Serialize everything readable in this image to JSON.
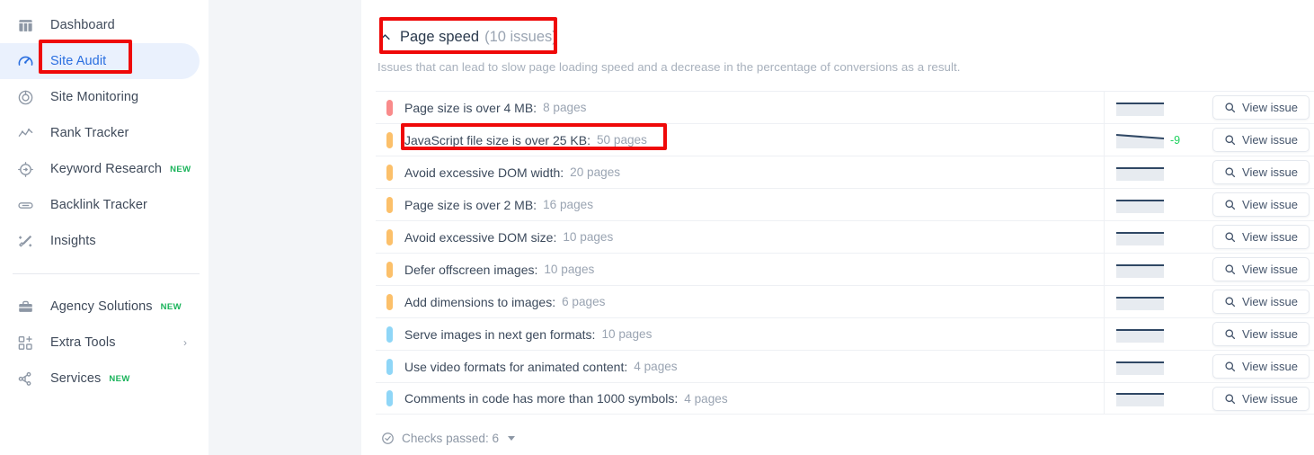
{
  "sidebar": {
    "items": [
      {
        "label": "Dashboard",
        "icon": "dashboard-icon",
        "active": false,
        "badge": "",
        "chevron": false
      },
      {
        "label": "Site Audit",
        "icon": "site-audit-icon",
        "active": true,
        "badge": "",
        "chevron": false
      },
      {
        "label": "Site Monitoring",
        "icon": "site-monitoring-icon",
        "active": false,
        "badge": "",
        "chevron": false
      },
      {
        "label": "Rank Tracker",
        "icon": "rank-tracker-icon",
        "active": false,
        "badge": "",
        "chevron": false
      },
      {
        "label": "Keyword Research",
        "icon": "keyword-research-icon",
        "active": false,
        "badge": "NEW",
        "chevron": false
      },
      {
        "label": "Backlink Tracker",
        "icon": "backlink-tracker-icon",
        "active": false,
        "badge": "",
        "chevron": false
      },
      {
        "label": "Insights",
        "icon": "insights-icon",
        "active": false,
        "badge": "",
        "chevron": false
      }
    ],
    "items_secondary": [
      {
        "label": "Agency Solutions",
        "icon": "briefcase-icon",
        "active": false,
        "badge": "NEW",
        "chevron": false
      },
      {
        "label": "Extra Tools",
        "icon": "extra-tools-icon",
        "active": false,
        "badge": "",
        "chevron": true
      },
      {
        "label": "Services",
        "icon": "services-icon",
        "active": false,
        "badge": "NEW",
        "chevron": false
      }
    ]
  },
  "section": {
    "collapse_icon": "chevron-up-icon",
    "title": "Page speed",
    "count": "(10 issues)",
    "description": "Issues that can lead to slow page loading speed and a decrease in the percentage of conversions as a result."
  },
  "issues": {
    "view_issue_label": "View issue",
    "search_icon": "search-icon",
    "rows": [
      {
        "label": "Page size is over 4 MB:",
        "count": "8 pages",
        "severity": "critical",
        "severity_color": "#f98b8b",
        "delta": "",
        "spark_slope": 0
      },
      {
        "label": "JavaScript file size is over 25 KB:",
        "count": "50 pages",
        "severity": "warning",
        "severity_color": "#fcc06a",
        "delta": "-9",
        "spark_slope": 1
      },
      {
        "label": "Avoid excessive DOM width:",
        "count": "20 pages",
        "severity": "warning",
        "severity_color": "#fcc06a",
        "delta": "",
        "spark_slope": 0
      },
      {
        "label": "Page size is over 2 MB:",
        "count": "16 pages",
        "severity": "warning",
        "severity_color": "#fcc06a",
        "delta": "",
        "spark_slope": 0
      },
      {
        "label": "Avoid excessive DOM size:",
        "count": "10 pages",
        "severity": "warning",
        "severity_color": "#fcc06a",
        "delta": "",
        "spark_slope": 0
      },
      {
        "label": "Defer offscreen images:",
        "count": "10 pages",
        "severity": "warning",
        "severity_color": "#fcc06a",
        "delta": "",
        "spark_slope": 0
      },
      {
        "label": "Add dimensions to images:",
        "count": "6 pages",
        "severity": "warning",
        "severity_color": "#fcc06a",
        "delta": "",
        "spark_slope": 0
      },
      {
        "label": "Serve images in next gen formats:",
        "count": "10 pages",
        "severity": "notice",
        "severity_color": "#8fd6f7",
        "delta": "",
        "spark_slope": 0
      },
      {
        "label": "Use video formats for animated content:",
        "count": "4 pages",
        "severity": "notice",
        "severity_color": "#8fd6f7",
        "delta": "",
        "spark_slope": 0
      },
      {
        "label": "Comments in code has more than 1000 symbols:",
        "count": "4 pages",
        "severity": "notice",
        "severity_color": "#8fd6f7",
        "delta": "",
        "spark_slope": 0
      }
    ]
  },
  "footer": {
    "checks_icon": "check-circle-icon",
    "checks_label": "Checks passed: 6"
  },
  "highlights": [
    {
      "name": "site-audit",
      "color": "#ef0909"
    },
    {
      "name": "page-speed-heading",
      "color": "#ef0909"
    },
    {
      "name": "javascript-file-size-row",
      "color": "#ef0909"
    }
  ]
}
